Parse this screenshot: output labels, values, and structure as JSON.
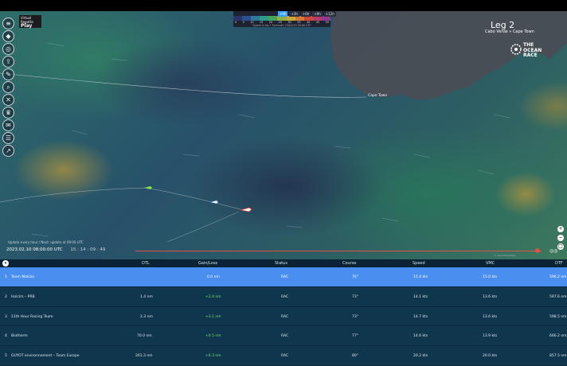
{
  "app": {
    "brand_logo_lines": [
      "Virtual",
      "Regatta",
      "Play"
    ],
    "leg_title": "Leg 2",
    "leg_route": "Cabo Verde » Cape Town",
    "race_logo_lines": [
      "THE",
      "OCEAN",
      "RACE"
    ]
  },
  "map": {
    "city_label": "Cape Town",
    "wind_scale": {
      "time_tabs": [
        "+0h",
        "+3h",
        "+6h",
        "+9h",
        "+12h"
      ],
      "active_tab": "+0h",
      "values": [
        "0",
        "5",
        "10",
        "15",
        "20",
        "25",
        "30",
        "35",
        "40",
        "45",
        "50"
      ],
      "caption": "Speed in kts • Forecast: 23/02/10 00:00 UTC",
      "colors": [
        "#2a3566",
        "#2c4f8f",
        "#2e7a9a",
        "#2f9a86",
        "#48a45a",
        "#8fb042",
        "#c9a83a",
        "#d07a33",
        "#c94a39",
        "#b83a6b",
        "#8e3a8e"
      ]
    },
    "sidebar_icons": [
      "layers-icon",
      "boat-icon",
      "target-icon",
      "share-icon",
      "ruler-icon",
      "search-icon",
      "tools-icon",
      "trophy-icon",
      "chat-icon",
      "menu-icon",
      "chart-icon"
    ],
    "update_info": "Update every hour / Next: update at 09:00 UTC",
    "timestamp": "2023.02.10 08:00:00 UTC",
    "countdown": "15 : 14 : 09 : 49",
    "copyright": "© OpenStreetMap",
    "right_controls": [
      "+",
      "−",
      "□"
    ]
  },
  "table": {
    "headers": {
      "dtl": "DTL",
      "gain": "Gain/Loss",
      "status": "Status",
      "course": "Course",
      "speed": "Speed",
      "vmc": "VMC",
      "dtf": "DTF"
    },
    "rows": [
      {
        "rank": "1",
        "team": "Team Malizia",
        "dtl": "",
        "gain": "0.0 nm",
        "status": "RAC",
        "course": "76°",
        "speed": "15.4 kts",
        "vmc": "15.0 kts",
        "dtf": "596.2 nm"
      },
      {
        "rank": "2",
        "team": "Holcim – PRB",
        "dtl": "1.4 nm",
        "gain": "+2.4 nm",
        "status": "RAC",
        "course": "73°",
        "speed": "14.1 kts",
        "vmc": "13.6 kts",
        "dtf": "597.6 nm"
      },
      {
        "rank": "3",
        "team": "11th Hour Racing Team",
        "dtl": "2.3 nm",
        "gain": "+3.1 nm",
        "status": "RAC",
        "course": "73°",
        "speed": "14.7 kts",
        "vmc": "13.6 kts",
        "dtf": "598.5 nm"
      },
      {
        "rank": "4",
        "team": "Biotherm",
        "dtl": "70.0 nm",
        "gain": "+0.5 nm",
        "status": "RAC",
        "course": "77°",
        "speed": "14.6 kts",
        "vmc": "13.9 kts",
        "dtf": "666.2 nm"
      },
      {
        "rank": "5",
        "team": "GUYOT environnement – Team Europe",
        "dtl": "261.3 nm",
        "gain": "+6.3 nm",
        "status": "RAC",
        "course": "80°",
        "speed": "20.2 kts",
        "vmc": "20.0 kts",
        "dtf": "857.5 nm"
      }
    ]
  },
  "colors": {
    "active_row": "#4a8ff0",
    "row": "#10364d",
    "header": "#0a2436",
    "gain_positive": "#6fe36f",
    "timeline": "#e05044"
  }
}
